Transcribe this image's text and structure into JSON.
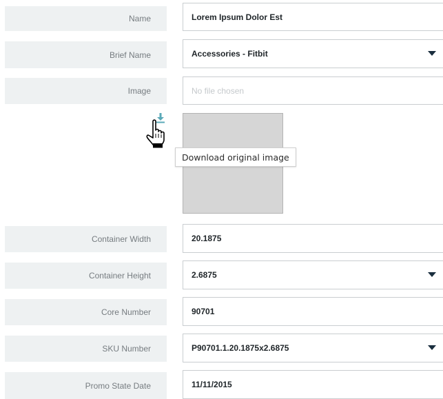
{
  "form": {
    "name": {
      "label": "Name",
      "value": "Lorem Ipsum Dolor Est"
    },
    "brief_name": {
      "label": "Brief Name",
      "value": "Accessories - Fitbit"
    },
    "image": {
      "label": "Image",
      "placeholder": "No file chosen"
    },
    "container_width": {
      "label": "Container Width",
      "value": "20.1875"
    },
    "container_height": {
      "label": "Container Height",
      "value": "2.6875"
    },
    "core_number": {
      "label": "Core Number",
      "value": "90701"
    },
    "sku_number": {
      "label": "SKU Number",
      "value": "P90701.1.20.1875x2.6875"
    },
    "promo_state_date": {
      "label": "Promo State Date",
      "value": "11/11/2015"
    }
  },
  "image_preview": {
    "tooltip": "Download original image",
    "download_icon": "download-icon",
    "cursor_icon": "hand-pointer-icon"
  },
  "colors": {
    "label_background": "#eef1f2",
    "label_text": "#767c80",
    "field_border": "#c9cdd0",
    "value_text": "#1e2428",
    "dropdown_caret": "#1a2e3e",
    "preview_background": "#d6d6d6",
    "download_accent": "#5aa9b8"
  }
}
